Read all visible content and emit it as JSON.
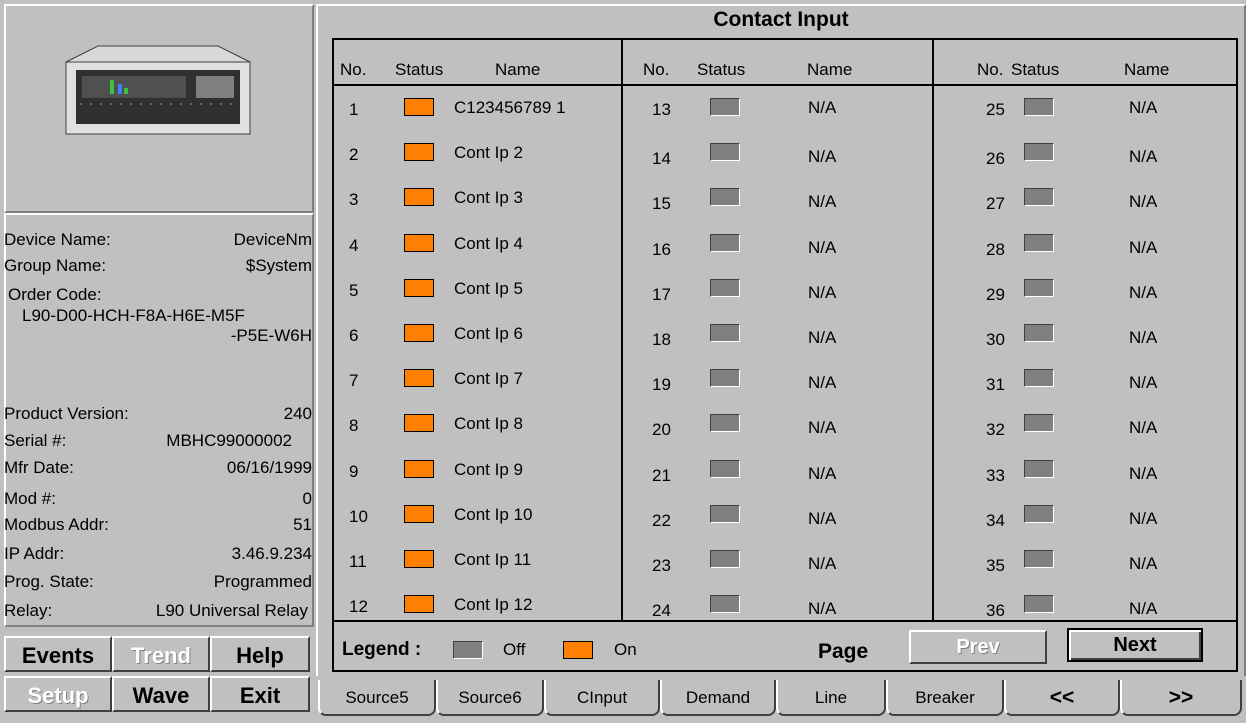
{
  "title": "Contact Input",
  "device": {
    "name_label": "Device Name:",
    "name_value": "DeviceNm",
    "group_label": "Group Name:",
    "group_value": "$System",
    "order_label": "Order Code:",
    "order_line1": "L90-D00-HCH-F8A-H6E-M5F",
    "order_line2": "-P5E-W6H",
    "version_label": "Product Version:",
    "version_value": "240",
    "serial_label": "Serial #:",
    "serial_value": "MBHC99000002",
    "mfr_label": "Mfr Date:",
    "mfr_value": "06/16/1999",
    "mod_label": "Mod #:",
    "mod_value": "0",
    "modbus_label": "Modbus Addr:",
    "modbus_value": "51",
    "ip_label": "IP Addr:",
    "ip_value": "3.46.9.234",
    "prog_label": "Prog. State:",
    "prog_value": "Programmed",
    "relay_label": "Relay:",
    "relay_value": "L90 Universal Relay"
  },
  "buttons": {
    "events": "Events",
    "trend": "Trend",
    "help": "Help",
    "setup": "Setup",
    "wave": "Wave",
    "exit": "Exit"
  },
  "headers": {
    "no": "No.",
    "status": "Status",
    "name": "Name"
  },
  "columns": [
    [
      {
        "no": "1",
        "state": "on",
        "name": "C123456789 1"
      },
      {
        "no": "2",
        "state": "on",
        "name": "Cont Ip 2"
      },
      {
        "no": "3",
        "state": "on",
        "name": "Cont Ip 3"
      },
      {
        "no": "4",
        "state": "on",
        "name": "Cont Ip 4"
      },
      {
        "no": "5",
        "state": "on",
        "name": "Cont Ip 5"
      },
      {
        "no": "6",
        "state": "on",
        "name": "Cont Ip 6"
      },
      {
        "no": "7",
        "state": "on",
        "name": "Cont Ip 7"
      },
      {
        "no": "8",
        "state": "on",
        "name": "Cont Ip 8"
      },
      {
        "no": "9",
        "state": "on",
        "name": "Cont Ip 9"
      },
      {
        "no": "10",
        "state": "on",
        "name": "Cont Ip 10"
      },
      {
        "no": "11",
        "state": "on",
        "name": "Cont Ip 11"
      },
      {
        "no": "12",
        "state": "on",
        "name": "Cont Ip 12"
      }
    ],
    [
      {
        "no": "13",
        "state": "off",
        "name": "N/A"
      },
      {
        "no": "14",
        "state": "off",
        "name": "N/A"
      },
      {
        "no": "15",
        "state": "off",
        "name": "N/A"
      },
      {
        "no": "16",
        "state": "off",
        "name": "N/A"
      },
      {
        "no": "17",
        "state": "off",
        "name": "N/A"
      },
      {
        "no": "18",
        "state": "off",
        "name": "N/A"
      },
      {
        "no": "19",
        "state": "off",
        "name": "N/A"
      },
      {
        "no": "20",
        "state": "off",
        "name": "N/A"
      },
      {
        "no": "21",
        "state": "off",
        "name": "N/A"
      },
      {
        "no": "22",
        "state": "off",
        "name": "N/A"
      },
      {
        "no": "23",
        "state": "off",
        "name": "N/A"
      },
      {
        "no": "24",
        "state": "off",
        "name": "N/A"
      }
    ],
    [
      {
        "no": "25",
        "state": "off",
        "name": "N/A"
      },
      {
        "no": "26",
        "state": "off",
        "name": "N/A"
      },
      {
        "no": "27",
        "state": "off",
        "name": "N/A"
      },
      {
        "no": "28",
        "state": "off",
        "name": "N/A"
      },
      {
        "no": "29",
        "state": "off",
        "name": "N/A"
      },
      {
        "no": "30",
        "state": "off",
        "name": "N/A"
      },
      {
        "no": "31",
        "state": "off",
        "name": "N/A"
      },
      {
        "no": "32",
        "state": "off",
        "name": "N/A"
      },
      {
        "no": "33",
        "state": "off",
        "name": "N/A"
      },
      {
        "no": "34",
        "state": "off",
        "name": "N/A"
      },
      {
        "no": "35",
        "state": "off",
        "name": "N/A"
      },
      {
        "no": "36",
        "state": "off",
        "name": "N/A"
      }
    ]
  ],
  "legend": {
    "label": "Legend :",
    "off": "Off",
    "on": "On",
    "page": "Page",
    "prev": "Prev",
    "next": "Next"
  },
  "tabs": [
    "Source5",
    "Source6",
    "CInput",
    "Demand",
    "Line",
    "Breaker",
    "<<",
    ">>"
  ],
  "colors": {
    "on": "#ff8000",
    "off": "#808080",
    "background": "#c0c0c0"
  }
}
